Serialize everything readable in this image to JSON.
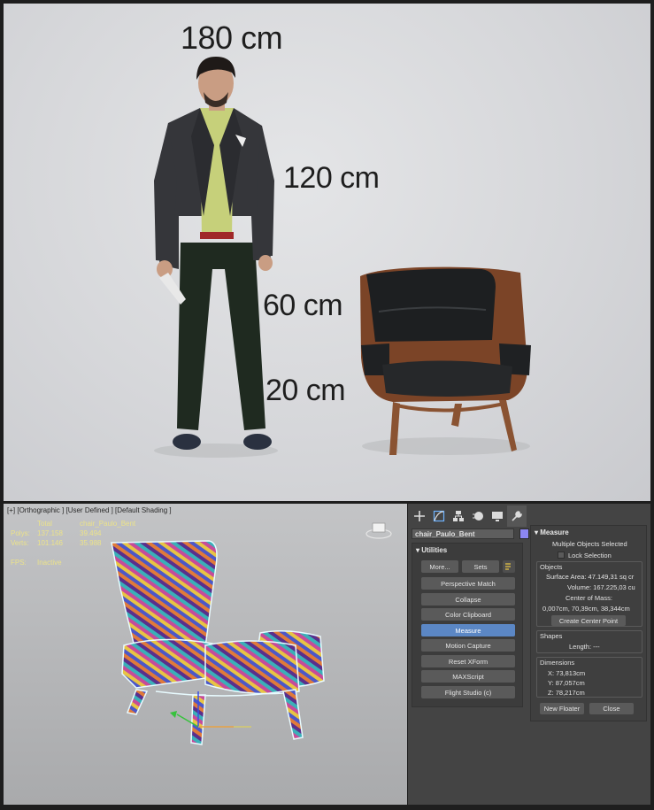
{
  "render": {
    "labels": {
      "h180": "180 cm",
      "h120": "120 cm",
      "h60": "60 cm",
      "h20": "20 cm"
    }
  },
  "viewport": {
    "header": "[+] [Orthographic ] [User Defined ] [Default Shading ]",
    "stats": {
      "total_label": "Total",
      "object_label": "chair_Paulo_Bent",
      "polys_label": "Polys:",
      "polys_total": "137.158",
      "polys_object": "39.494",
      "verts_label": "Verts:",
      "verts_total": "101.146",
      "verts_object": "35.988",
      "fps_label": "FPS:",
      "fps_value": "Inactive"
    }
  },
  "panel": {
    "object_name": "chair_Paulo_Bent",
    "swatch_color": "#8c86f2",
    "utilities": {
      "title": "Utilities",
      "more": "More...",
      "sets": "Sets",
      "buttons": [
        "Perspective Match",
        "Collapse",
        "Color Clipboard",
        "Measure",
        "Motion Capture",
        "Reset XForm",
        "MAXScript",
        "Flight Studio (c)"
      ],
      "active_index": 3
    },
    "measure": {
      "title": "Measure",
      "selection": "Multiple Objects Selected",
      "lock": "Lock Selection",
      "objects_title": "Objects",
      "surface_area": "Surface Area:  47.149,31 sq cr",
      "volume": "Volume:  167.225,03 cu",
      "center_label": "Center of Mass:",
      "center_value": "0,007cm, 70,39cm, 38,344cm",
      "create_center": "Create Center Point",
      "shapes_title": "Shapes",
      "length": "Length:  ---",
      "dims_title": "Dimensions",
      "x": "X:   73,813cm",
      "y": "Y:   87,057cm",
      "z": "Z:   78,217cm",
      "new_floater": "New Floater",
      "close": "Close"
    }
  }
}
